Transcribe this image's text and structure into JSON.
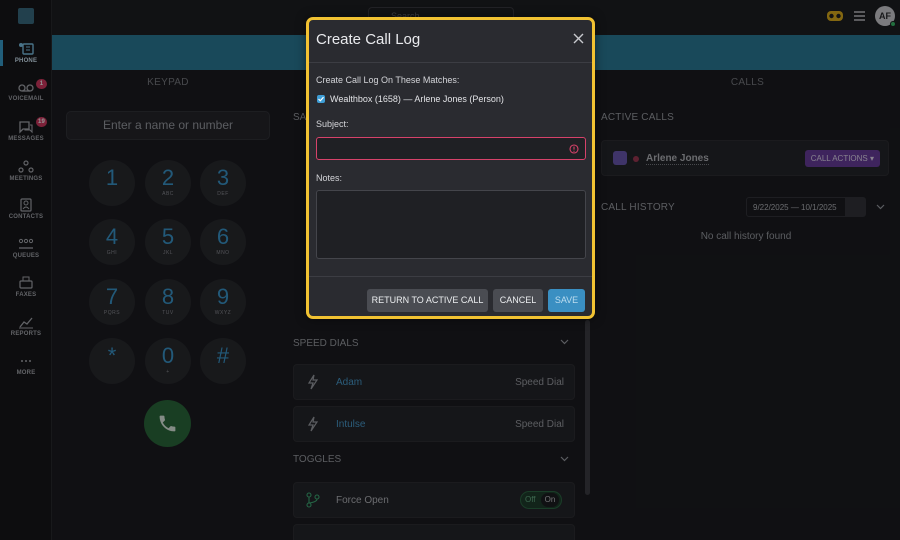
{
  "nav": {
    "items": [
      {
        "label": "PHONE",
        "icon": "phone-grid-icon",
        "active": true
      },
      {
        "label": "VOICEMAIL",
        "icon": "voicemail-icon",
        "badge": "1"
      },
      {
        "label": "MESSAGES",
        "icon": "chat-icon",
        "badge": "19"
      },
      {
        "label": "MEETINGS",
        "icon": "meetings-icon"
      },
      {
        "label": "CONTACTS",
        "icon": "contacts-icon"
      },
      {
        "label": "QUEUES",
        "icon": "queues-icon"
      },
      {
        "label": "FAXES",
        "icon": "fax-icon"
      },
      {
        "label": "REPORTS",
        "icon": "reports-icon"
      },
      {
        "label": "MORE",
        "icon": "more-icon"
      }
    ]
  },
  "topbar": {
    "search_placeholder": "Search",
    "avatar_initials": "AF"
  },
  "columns": {
    "keypad": "KEYPAD",
    "calls": "CALLS"
  },
  "keypad": {
    "input_placeholder": "Enter a name or number",
    "keys": [
      {
        "digit": "1",
        "letters": ""
      },
      {
        "digit": "2",
        "letters": "ABC"
      },
      {
        "digit": "3",
        "letters": "DEF"
      },
      {
        "digit": "4",
        "letters": "GHI"
      },
      {
        "digit": "5",
        "letters": "JKL"
      },
      {
        "digit": "6",
        "letters": "MNO"
      },
      {
        "digit": "7",
        "letters": "PQRS"
      },
      {
        "digit": "8",
        "letters": "TUV"
      },
      {
        "digit": "9",
        "letters": "WXYZ"
      },
      {
        "digit": "*",
        "letters": ""
      },
      {
        "digit": "0",
        "letters": "+"
      },
      {
        "digit": "#",
        "letters": ""
      }
    ]
  },
  "middle": {
    "partial_label": "SA",
    "speed_dials_label": "SPEED DIALS",
    "speed_dials": [
      {
        "name": "Adam",
        "type": "Speed Dial"
      },
      {
        "name": "Intulse",
        "type": "Speed Dial"
      }
    ],
    "toggles_label": "TOGGLES",
    "toggles": [
      {
        "name": "Force Open",
        "off": "Off",
        "on": "On"
      }
    ]
  },
  "right": {
    "active_calls_label": "ACTIVE CALLS",
    "active_call_name": "Arlene Jones",
    "call_actions": "CALL ACTIONS ▾",
    "call_history_label": "CALL HISTORY",
    "date_range": "9/22/2025 — 10/1/2025",
    "no_history": "No call history found"
  },
  "modal": {
    "title": "Create Call Log",
    "matches_label": "Create Call Log On These Matches:",
    "match": "Wealthbox (1658) — Arlene Jones (Person)",
    "match_checked": true,
    "subject_label": "Subject:",
    "subject_value": "",
    "notes_label": "Notes:",
    "notes_value": "",
    "buttons": {
      "return": "RETURN TO ACTIVE CALL",
      "cancel": "CANCEL",
      "save": "SAVE"
    }
  },
  "colors": {
    "accent": "#3aa3d2",
    "modal_border": "#f1c232",
    "error": "#d6426a",
    "call_actions": "#6b3fa0"
  }
}
